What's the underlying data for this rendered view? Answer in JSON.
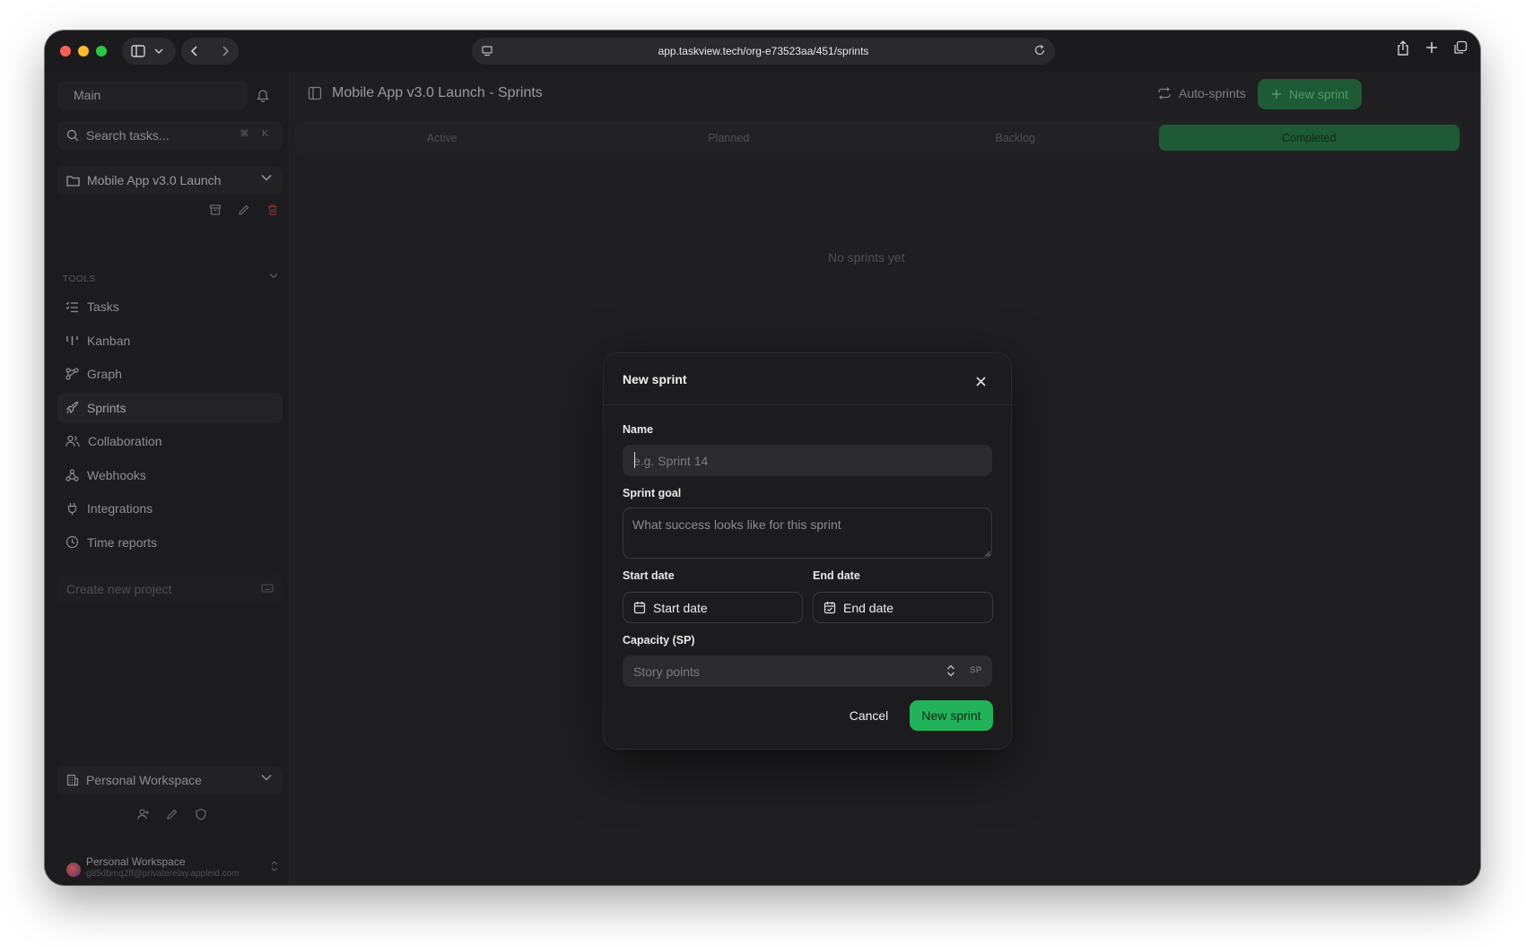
{
  "browser": {
    "url": "app.taskview.tech/org-e73523aa/451/sprints"
  },
  "sidebar": {
    "workspace_label": "Main",
    "search_placeholder": "Search tasks...",
    "search_shortcut": "⌘ K",
    "project_name": "Mobile App v3.0 Launch",
    "tools_label": "TOOLS",
    "items": [
      {
        "label": "Tasks",
        "icon": "tasks-icon"
      },
      {
        "label": "Kanban",
        "icon": "kanban-icon"
      },
      {
        "label": "Graph",
        "icon": "graph-icon"
      },
      {
        "label": "Sprints",
        "icon": "rocket-icon"
      },
      {
        "label": "Collaboration",
        "icon": "users-icon"
      },
      {
        "label": "Webhooks",
        "icon": "webhook-icon"
      },
      {
        "label": "Integrations",
        "icon": "plug-icon"
      },
      {
        "label": "Time reports",
        "icon": "clock-icon"
      }
    ],
    "create_project_label": "Create new project",
    "personal_workspace": "Personal Workspace",
    "user_name": "Personal Workspace",
    "user_email": "g85dbmq2ff@privaterelay.appleid.com"
  },
  "header": {
    "title": "Mobile App v3.0 Launch - Sprints",
    "auto_sprints": "Auto-sprints",
    "new_sprint": "New sprint"
  },
  "tabs": [
    {
      "label": "Active"
    },
    {
      "label": "Planned"
    },
    {
      "label": "Backlog"
    },
    {
      "label": "Completed"
    }
  ],
  "empty_message": "No sprints yet",
  "modal": {
    "title": "New sprint",
    "name_label": "Name",
    "name_placeholder": "e.g. Sprint 14",
    "goal_label": "Sprint goal",
    "goal_placeholder": "What success looks like for this sprint",
    "start_label": "Start date",
    "start_button": "Start date",
    "end_label": "End date",
    "end_button": "End date",
    "capacity_label": "Capacity (SP)",
    "capacity_placeholder": "Story points",
    "capacity_unit": "SP",
    "cancel": "Cancel",
    "submit": "New sprint"
  },
  "colors": {
    "accent_green": "#22b35a",
    "background": "#1f1f21",
    "modal_bg": "#1c1c1e"
  }
}
